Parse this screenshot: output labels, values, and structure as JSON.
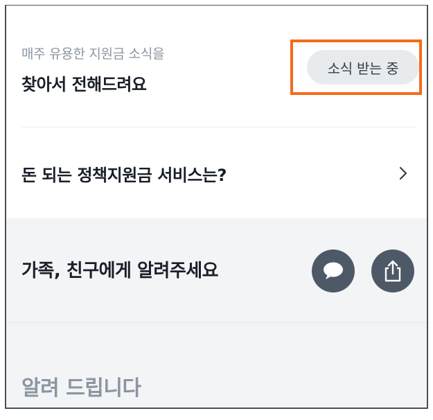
{
  "subscription": {
    "caption": "매주 유용한 지원금 소식을",
    "headline": "찾아서 전해드려요",
    "button_label": "소식 받는 중"
  },
  "policy_link": {
    "label": "돈 되는 정책지원금 서비스는?"
  },
  "share": {
    "label": "가족, 친구에게 알려주세요",
    "kakao_icon": "speech-bubble-icon",
    "share_icon": "share-upload-icon"
  },
  "notice": {
    "label": "알려 드립니다"
  },
  "colors": {
    "highlight": "#f46a1c",
    "icon_button_bg": "#4e5968",
    "section_bg": "#f2f4f6"
  }
}
